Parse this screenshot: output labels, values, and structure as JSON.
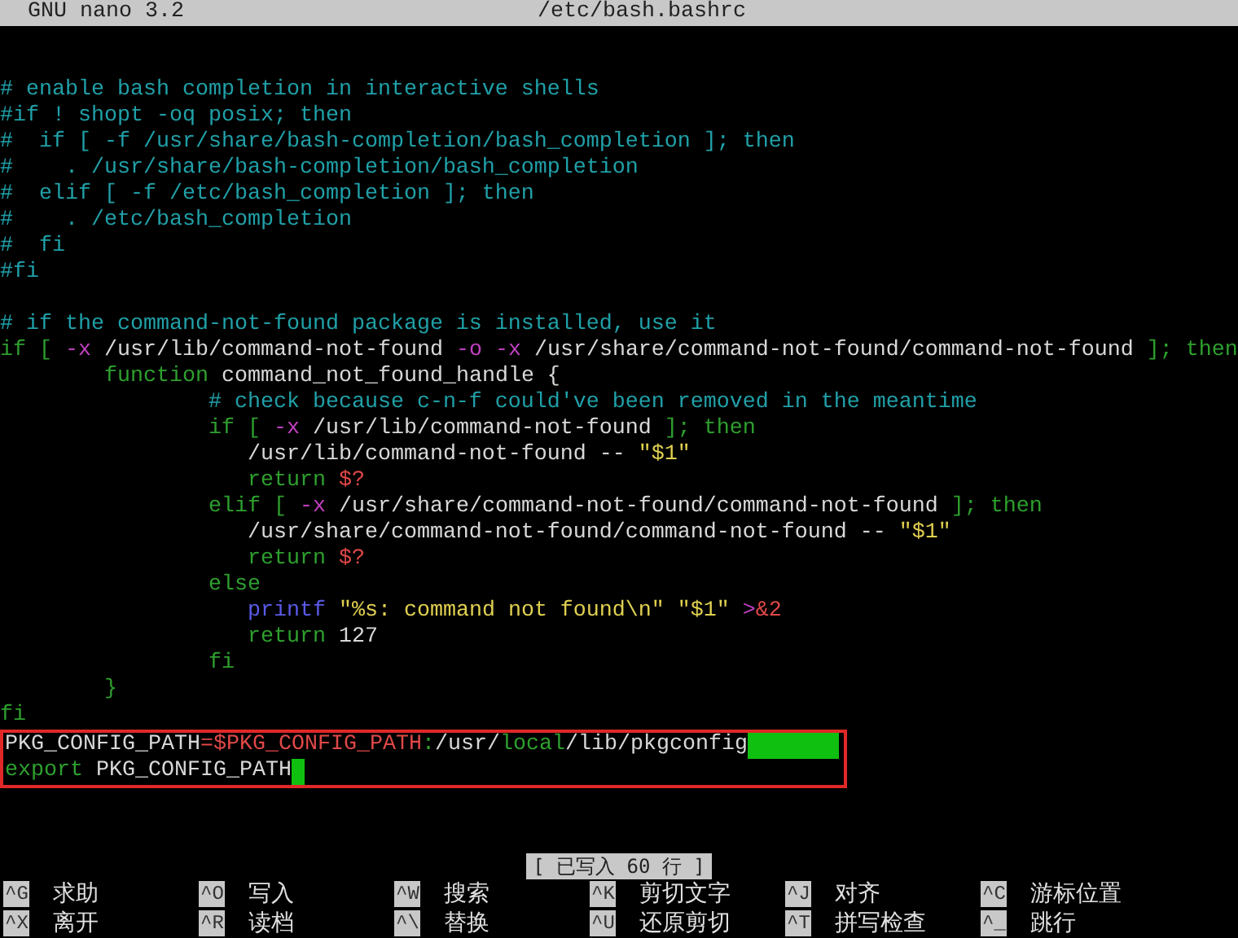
{
  "title_bar": {
    "app": "GNU nano 3.2",
    "file": "/etc/bash.bashrc"
  },
  "lines": [
    {
      "segments": [
        {
          "kind": "comment",
          "text": "# enable bash completion in interactive shells"
        }
      ]
    },
    {
      "segments": [
        {
          "kind": "comment",
          "text": "#if ! shopt -oq posix; then"
        }
      ]
    },
    {
      "segments": [
        {
          "kind": "comment",
          "text": "#  if [ -f /usr/share/bash-completion/bash_completion ]; then"
        }
      ]
    },
    {
      "segments": [
        {
          "kind": "comment",
          "text": "#    . /usr/share/bash-completion/bash_completion"
        }
      ]
    },
    {
      "segments": [
        {
          "kind": "comment",
          "text": "#  elif [ -f /etc/bash_completion ]; then"
        }
      ]
    },
    {
      "segments": [
        {
          "kind": "comment",
          "text": "#    . /etc/bash_completion"
        }
      ]
    },
    {
      "segments": [
        {
          "kind": "comment",
          "text": "#  fi"
        }
      ]
    },
    {
      "segments": [
        {
          "kind": "comment",
          "text": "#fi"
        }
      ]
    },
    {
      "blank_before": true,
      "segments": [
        {
          "kind": "comment",
          "text": "# if the command-not-found package is installed, use it"
        }
      ]
    },
    {
      "segments": [
        {
          "kind": "keyword",
          "text": "if [ "
        },
        {
          "kind": "operator",
          "text": "-x"
        },
        {
          "kind": "plain",
          "text": " /usr/lib/command-not-found "
        },
        {
          "kind": "operator",
          "text": "-o -x"
        },
        {
          "kind": "plain",
          "text": " /usr/share/command-not-found/command-not-found "
        },
        {
          "kind": "keyword",
          "text": "]; then"
        }
      ]
    },
    {
      "segments": [
        {
          "kind": "keyword",
          "text": "        function"
        },
        {
          "kind": "plain",
          "text": " command_not_found_handle {"
        }
      ]
    },
    {
      "segments": [
        {
          "kind": "comment",
          "text": "                # check because c-n-f could've been removed in the meantime"
        }
      ]
    },
    {
      "segments": [
        {
          "kind": "keyword",
          "text": "                if [ "
        },
        {
          "kind": "operator",
          "text": "-x"
        },
        {
          "kind": "plain",
          "text": " /usr/lib/command-not-found "
        },
        {
          "kind": "keyword",
          "text": "]; then"
        }
      ]
    },
    {
      "segments": [
        {
          "kind": "plain",
          "text": "                   /usr/lib/command-not-found -- "
        },
        {
          "kind": "string",
          "text": "\"$1\""
        }
      ]
    },
    {
      "segments": [
        {
          "kind": "keyword",
          "text": "                   return "
        },
        {
          "kind": "variable",
          "text": "$?"
        }
      ]
    },
    {
      "segments": [
        {
          "kind": "keyword",
          "text": "                elif [ "
        },
        {
          "kind": "operator",
          "text": "-x"
        },
        {
          "kind": "plain",
          "text": " /usr/share/command-not-found/command-not-found "
        },
        {
          "kind": "keyword",
          "text": "]; then"
        }
      ]
    },
    {
      "segments": [
        {
          "kind": "plain",
          "text": "                   /usr/share/command-not-found/command-not-found -- "
        },
        {
          "kind": "string",
          "text": "\"$1\""
        }
      ]
    },
    {
      "segments": [
        {
          "kind": "keyword",
          "text": "                   return "
        },
        {
          "kind": "variable",
          "text": "$?"
        }
      ]
    },
    {
      "segments": [
        {
          "kind": "keyword",
          "text": "                else"
        }
      ]
    },
    {
      "segments": [
        {
          "kind": "builtin",
          "text": "                   printf"
        },
        {
          "kind": "string",
          "text": " \"%s: command not found\\n\" \"$1\" "
        },
        {
          "kind": "operator",
          "text": ">"
        },
        {
          "kind": "variable",
          "text": "&2"
        }
      ]
    },
    {
      "segments": [
        {
          "kind": "keyword",
          "text": "                   return"
        },
        {
          "kind": "plain",
          "text": " 127"
        }
      ]
    },
    {
      "segments": [
        {
          "kind": "keyword",
          "text": "                fi"
        }
      ]
    },
    {
      "segments": [
        {
          "kind": "keyword",
          "text": "        }"
        }
      ]
    },
    {
      "segments": [
        {
          "kind": "keyword",
          "text": "fi"
        }
      ]
    },
    {
      "boxed": true,
      "trailing_whitespace": true,
      "segments": [
        {
          "kind": "plain",
          "text": "PKG_CONFIG_PATH"
        },
        {
          "kind": "variable",
          "text": "=$PKG_CONFIG_PATH"
        },
        {
          "kind": "keyword",
          "text": ":"
        },
        {
          "kind": "plain",
          "text": "/usr/"
        },
        {
          "kind": "keyword",
          "text": "local"
        },
        {
          "kind": "plain",
          "text": "/lib/pkgconfig"
        }
      ]
    },
    {
      "boxed": true,
      "cursor": true,
      "segments": [
        {
          "kind": "keyword",
          "text": "export"
        },
        {
          "kind": "plain",
          "text": " PKG_CONFIG_PATH"
        }
      ]
    }
  ],
  "status": "[ 已写入 60 行 ]",
  "shortcuts": [
    [
      {
        "key": "^G",
        "label": "求助"
      },
      {
        "key": "^O",
        "label": "写入"
      },
      {
        "key": "^W",
        "label": "搜索"
      },
      {
        "key": "^K",
        "label": "剪切文字"
      },
      {
        "key": "^J",
        "label": "对齐"
      },
      {
        "key": "^C",
        "label": "游标位置"
      }
    ],
    [
      {
        "key": "^X",
        "label": "离开"
      },
      {
        "key": "^R",
        "label": "读档"
      },
      {
        "key": "^\\",
        "label": "替换"
      },
      {
        "key": "^U",
        "label": "还原剪切"
      },
      {
        "key": "^T",
        "label": "拼写检查"
      },
      {
        "key": "^_",
        "label": "跳行"
      }
    ]
  ]
}
